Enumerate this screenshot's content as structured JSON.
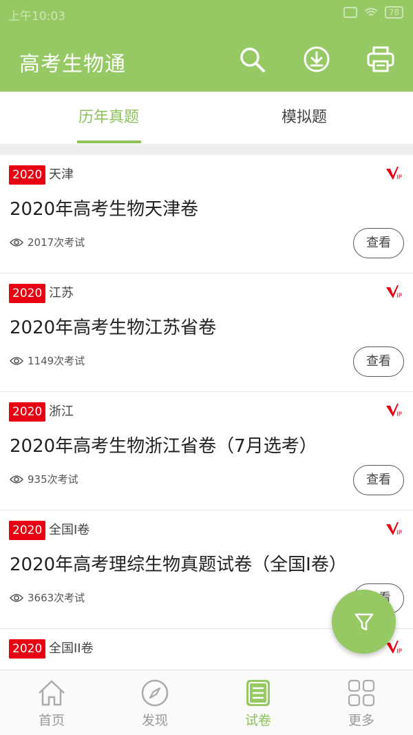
{
  "status_bar": {
    "time": "上午10:03",
    "battery": "78"
  },
  "app": {
    "title": "高考生物通",
    "accent": "#96c864",
    "badge_color": "#e50012"
  },
  "header_icons": [
    "search-icon",
    "download-icon",
    "printer-icon"
  ],
  "tabs": [
    {
      "label": "历年真题",
      "active": true
    },
    {
      "label": "模拟题",
      "active": false
    }
  ],
  "papers": [
    {
      "year": "2020",
      "region": "天津",
      "title": "2020年高考生物天津卷",
      "views": "2017次考试",
      "action": "查看"
    },
    {
      "year": "2020",
      "region": "江苏",
      "title": "2020年高考生物江苏省卷",
      "views": "1149次考试",
      "action": "查看"
    },
    {
      "year": "2020",
      "region": "浙江",
      "title": "2020年高考生物浙江省卷（7月选考）",
      "views": "935次考试",
      "action": "查看"
    },
    {
      "year": "2020",
      "region": "全国I卷",
      "title": "2020年高考理综生物真题试卷（全国I卷）",
      "views": "3663次考试",
      "action": "查看"
    },
    {
      "year": "2020",
      "region": "全国II卷",
      "title": "",
      "views": "",
      "action": ""
    }
  ],
  "bottom_nav": [
    {
      "label": "首页",
      "icon": "home-icon",
      "active": false
    },
    {
      "label": "发现",
      "icon": "compass-icon",
      "active": false
    },
    {
      "label": "试卷",
      "icon": "paper-list-icon",
      "active": true
    },
    {
      "label": "更多",
      "icon": "grid-icon",
      "active": false
    }
  ]
}
